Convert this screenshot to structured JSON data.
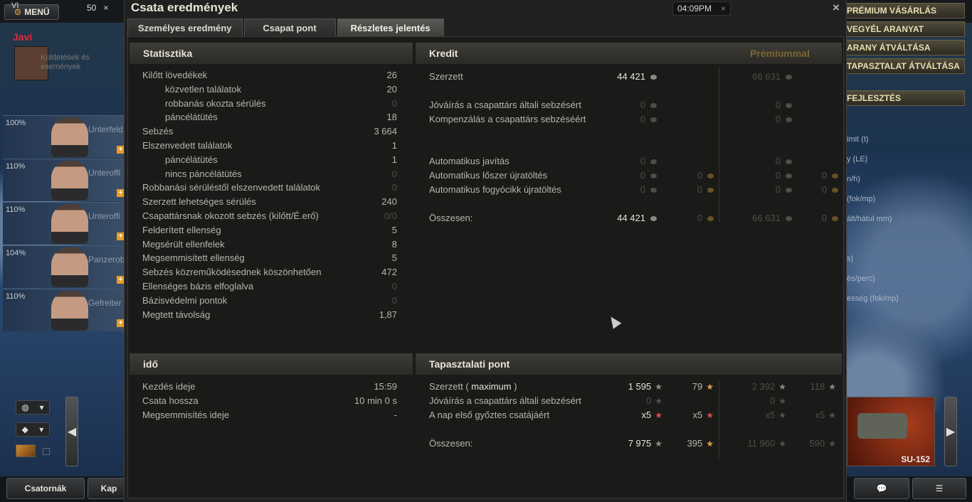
{
  "garage": {
    "menu_label": "MENÜ",
    "counter": "50",
    "counter_close": "×",
    "notice_label": "Küldetések és események",
    "crew": [
      {
        "pct": "100%",
        "role": "Unterfeld"
      },
      {
        "pct": "110%",
        "role": "Unteroffi"
      },
      {
        "pct": "110%",
        "role": "Unteroffi"
      },
      {
        "pct": "104%",
        "role": "Panzerob"
      },
      {
        "pct": "110%",
        "role": "Gefreiter"
      }
    ],
    "right_menu": [
      "PRÉMIUM VÁSÁRLÁS",
      "VEGYÉL ARANYAT",
      "ARANY ÁTVÁLTÁSA",
      "TAPASZTALAT ÁTVÁLTÁSA",
      "FEJLESZTÉS"
    ],
    "right_stats": [
      "imit (t)",
      "y (LE)",
      "n/h)",
      "(fok/mp)",
      "ált/hátul mm)",
      "s)",
      "és/perc)",
      "esség (fok/mp)"
    ],
    "tank_left": {
      "tier": "VI",
      "label": "Javí"
    },
    "tank_right": {
      "name": "SU-152"
    },
    "bottom_left": "Csatornák",
    "bottom_left2": "Kap"
  },
  "window": {
    "title": "Csata eredmények",
    "time": "04:09PM",
    "time_close": "×",
    "close": "×",
    "tabs": [
      "Személyes eredmény",
      "Csapat pont",
      "Részletes jelentés"
    ]
  },
  "stats": {
    "title": "Statisztika",
    "rows": [
      {
        "label": "Kilőtt lövedékek",
        "value": "26",
        "indent": false,
        "dim": false
      },
      {
        "label": "közvetlen találatok",
        "value": "20",
        "indent": true,
        "dim": false
      },
      {
        "label": "robbanás okozta sérülés",
        "value": "0",
        "indent": true,
        "dim": true
      },
      {
        "label": "páncélátütés",
        "value": "18",
        "indent": true,
        "dim": false
      },
      {
        "label": "Sebzés",
        "value": "3 664",
        "indent": false,
        "dim": false
      },
      {
        "label": "Elszenvedett találatok",
        "value": "1",
        "indent": false,
        "dim": false
      },
      {
        "label": "páncélátütés",
        "value": "1",
        "indent": true,
        "dim": false
      },
      {
        "label": "nincs páncélátütés",
        "value": "0",
        "indent": true,
        "dim": true
      },
      {
        "label": "Robbanási sérüléstől elszenvedett találatok",
        "value": "0",
        "indent": false,
        "dim": true
      },
      {
        "label": "Szerzett lehetséges sérülés",
        "value": "240",
        "indent": false,
        "dim": false
      },
      {
        "label": "Csapattársnak okozott sebzés (kilőtt/É.erő)",
        "value": "0/0",
        "indent": false,
        "dim": true
      },
      {
        "label": "Felderített ellenség",
        "value": "5",
        "indent": false,
        "dim": false
      },
      {
        "label": "Megsérült ellenfelek",
        "value": "8",
        "indent": false,
        "dim": false
      },
      {
        "label": "Megsemmisített ellenség",
        "value": "5",
        "indent": false,
        "dim": false
      },
      {
        "label": "Sebzés közreműködésednek köszönhetően",
        "value": "472",
        "indent": false,
        "dim": false
      },
      {
        "label": "Ellenséges bázis elfoglalva",
        "value": "0",
        "indent": false,
        "dim": true
      },
      {
        "label": "Bázisvédelmi pontok",
        "value": "0",
        "indent": false,
        "dim": true
      },
      {
        "label": "Megtett távolság",
        "value": "1,87",
        "indent": false,
        "dim": false
      }
    ]
  },
  "time": {
    "title": "idő",
    "rows": [
      {
        "label": "Kezdés ideje",
        "value": "15:59"
      },
      {
        "label": "Csata hossza",
        "value": "10 min 0 s"
      },
      {
        "label": "Megsemmisítés ideje",
        "value": "-"
      }
    ]
  },
  "credit": {
    "title": "Kredit",
    "premium_label": "Prémiummal",
    "rows": [
      {
        "label": "Szerzett",
        "c1": "44 421",
        "g1": "",
        "c2": "66 631",
        "g2": "",
        "c1dim": false,
        "g1dim": true,
        "c2dim": true,
        "g2dim": true
      },
      {
        "label": "Jóváírás a csapattárs általi sebzésért",
        "c1": "0",
        "g1": "",
        "c2": "0",
        "g2": "",
        "c1dim": true,
        "g1dim": true,
        "c2dim": true,
        "g2dim": true
      },
      {
        "label": "Kompenzálás a csapattárs sebzéséért",
        "c1": "0",
        "g1": "",
        "c2": "0",
        "g2": "",
        "c1dim": true,
        "g1dim": true,
        "c2dim": true,
        "g2dim": true
      },
      {
        "label": "Automatikus javítás",
        "c1": "0",
        "g1": "",
        "c2": "0",
        "g2": "",
        "c1dim": true,
        "g1dim": true,
        "c2dim": true,
        "g2dim": true
      },
      {
        "label": "Automatikus lőszer újratöltés",
        "c1": "0",
        "g1": "0",
        "c2": "0",
        "g2": "0",
        "c1dim": true,
        "g1dim": true,
        "c2dim": true,
        "g2dim": true
      },
      {
        "label": "Automatikus fogyócikk újratöltés",
        "c1": "0",
        "g1": "0",
        "c2": "0",
        "g2": "0",
        "c1dim": true,
        "g1dim": true,
        "c2dim": true,
        "g2dim": true
      },
      {
        "label": "Összesen:",
        "c1": "44 421",
        "g1": "0",
        "c2": "66 631",
        "g2": "0",
        "c1dim": false,
        "g1dim": true,
        "c2dim": true,
        "g2dim": true
      }
    ]
  },
  "xp": {
    "title": "Tapasztalati pont",
    "earned_label": "Szerzett",
    "earned_paren_open": "(",
    "earned_max": "maximum",
    "earned_paren_close": ")",
    "rows": [
      {
        "label": "Jóváírás a csapattárs általi sebzésért",
        "x1": "0",
        "x2": "",
        "x3": "0",
        "x4": "",
        "x1dim": true,
        "x3dim": true
      },
      {
        "label": "A nap első győztes csatájáért",
        "x1": "x5",
        "x2": "x5",
        "x3": "x5",
        "x4": "x5",
        "x1dim": false,
        "x3dim": true
      },
      {
        "label": "Összesen:",
        "x1": "7 975",
        "x2": "395",
        "x3": "11 960",
        "x4": "590",
        "x1dim": false,
        "x3dim": true
      }
    ],
    "earned": {
      "x1": "1 595",
      "x2": "79",
      "x3": "2 392",
      "x4": "118"
    }
  }
}
